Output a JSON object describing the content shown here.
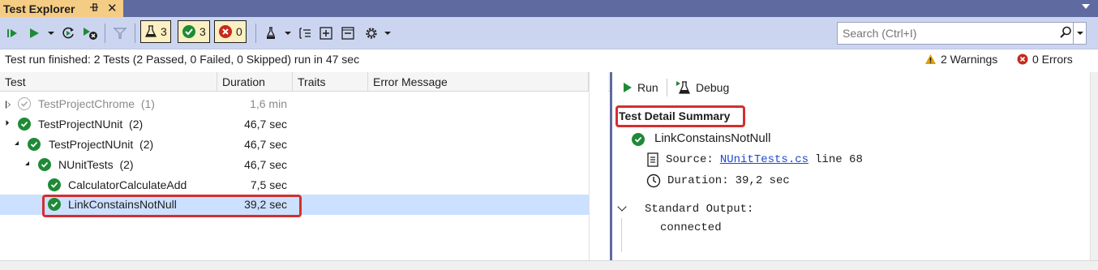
{
  "window": {
    "tab_title": "Test Explorer",
    "pin_glyph": "⊕",
    "close_glyph": "✕"
  },
  "toolbar": {
    "counters": {
      "total": "3",
      "passed": "3",
      "failed": "0"
    },
    "search_placeholder": "Search (Ctrl+I)"
  },
  "status": {
    "text": "Test run finished: 2 Tests (2 Passed, 0 Failed, 0 Skipped) run in 47 sec",
    "warnings": "2 Warnings",
    "errors": "0 Errors"
  },
  "columns": [
    "Test",
    "Duration",
    "Traits",
    "Error Message"
  ],
  "tests": [
    {
      "name": "TestProjectChrome",
      "count": "(1)",
      "duration": "1,6 min",
      "dimmed": true,
      "expanded": false
    },
    {
      "name": "TestProjectNUnit",
      "count": "(2)",
      "duration": "46,7 sec",
      "dimmed": false,
      "expanded": true
    },
    {
      "name": "TestProjectNUnit",
      "count": "(2)",
      "duration": "46,7 sec",
      "dimmed": false,
      "expanded": true
    },
    {
      "name": "NUnitTests",
      "count": "(2)",
      "duration": "46,7 sec",
      "dimmed": false,
      "expanded": true
    },
    {
      "name": "CalculatorCalculateAdd",
      "count": "",
      "duration": "7,5 sec",
      "dimmed": false,
      "expanded": null
    },
    {
      "name": "LinkConstainsNotNull",
      "count": "",
      "duration": "39,2 sec",
      "dimmed": false,
      "expanded": null,
      "selected": true
    }
  ],
  "detail": {
    "run_label": "Run",
    "debug_label": "Debug",
    "summary_title": "Test Detail Summary",
    "test_name": "LinkConstainsNotNull",
    "source_label": "Source:",
    "source_file": "NUnitTests.cs",
    "source_line": "line 68",
    "duration_label": "Duration:",
    "duration_value": "39,2 sec",
    "stdout_label": "Standard Output:",
    "stdout_value": "connected"
  },
  "colors": {
    "tab_active": "#f5cc84",
    "strip": "#5f6aa0",
    "toolbar": "#ccd5f0",
    "pass": "#1f8a36",
    "fail": "#c42b1c",
    "warn": "#e0a000",
    "selection": "#cce0ff",
    "highlight_box": "#d32f2f",
    "link": "#1a49d1"
  },
  "icons": [
    "run-all-icon",
    "run-icon",
    "refresh-icon",
    "cancel-run-icon",
    "filter-icon",
    "flask-icon",
    "check-icon",
    "error-icon",
    "playlist-icon",
    "group-icon",
    "expand-all-icon",
    "collapse-all-icon",
    "settings-icon",
    "search-icon",
    "warning-icon",
    "file-icon",
    "clock-icon"
  ]
}
